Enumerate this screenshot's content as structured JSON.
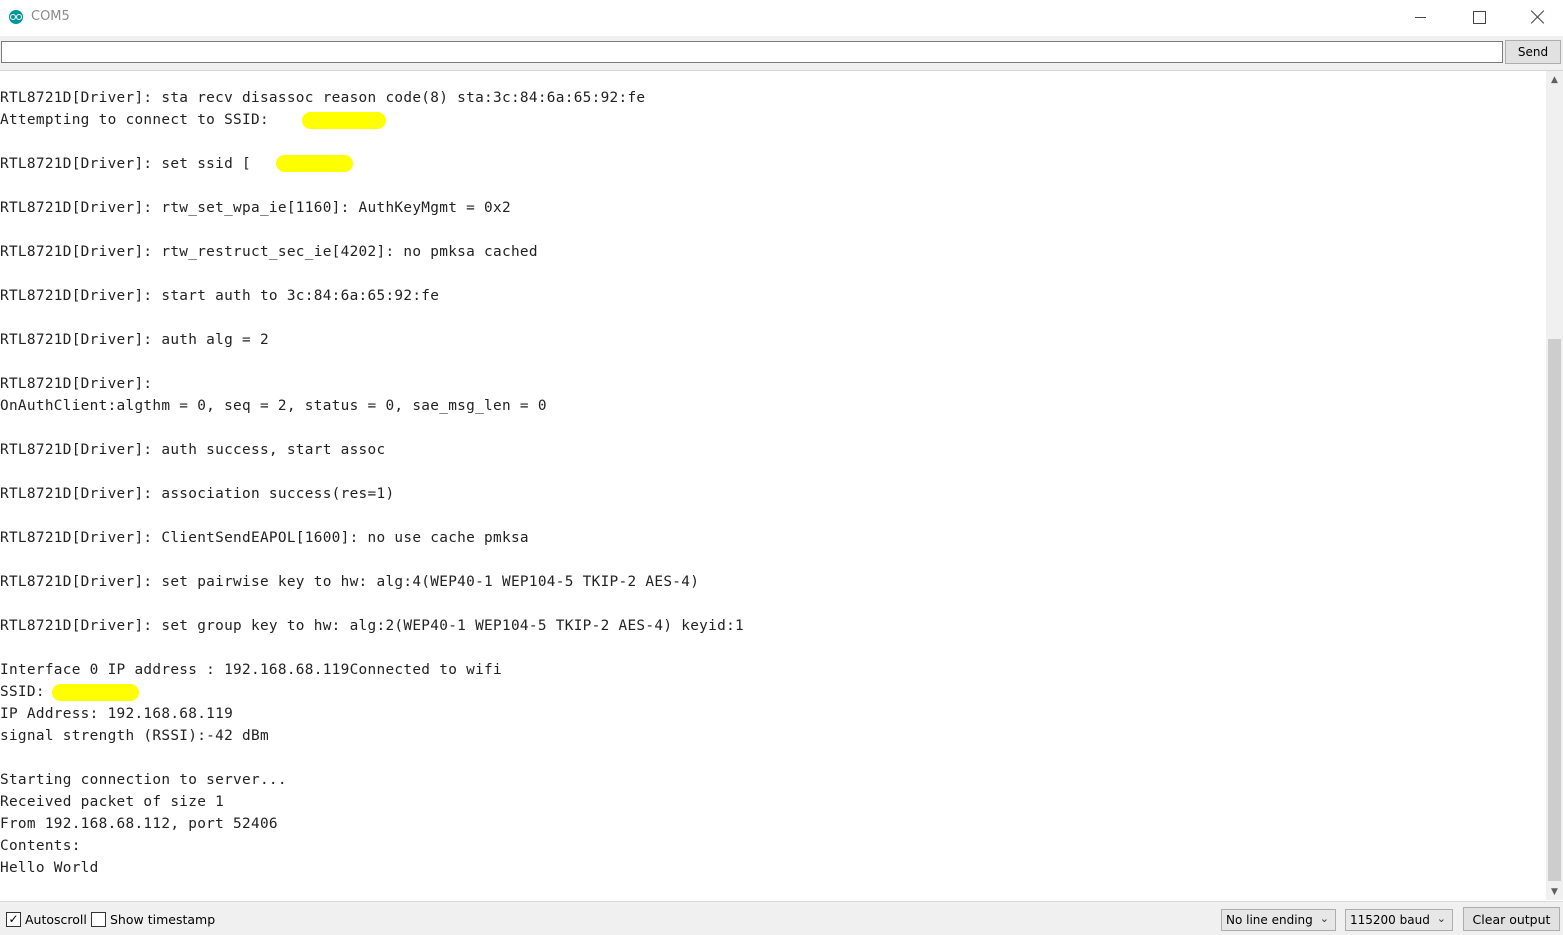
{
  "window": {
    "title": "COM5",
    "icon": "arduino-icon"
  },
  "send_bar": {
    "input_value": "",
    "send_label": "Send"
  },
  "output": {
    "lines": [
      "RTL8721D[Driver]: sta recv disassoc reason code(8) sta:3c:84:6a:65:92:fe",
      "Attempting to connect to SSID:",
      "",
      "RTL8721D[Driver]: set ssid [          ]",
      "",
      "RTL8721D[Driver]: rtw_set_wpa_ie[1160]: AuthKeyMgmt = 0x2",
      "",
      "RTL8721D[Driver]: rtw_restruct_sec_ie[4202]: no pmksa cached",
      "",
      "RTL8721D[Driver]: start auth to 3c:84:6a:65:92:fe",
      "",
      "RTL8721D[Driver]: auth alg = 2",
      "",
      "RTL8721D[Driver]:",
      "OnAuthClient:algthm = 0, seq = 2, status = 0, sae_msg_len = 0",
      "",
      "RTL8721D[Driver]: auth success, start assoc",
      "",
      "RTL8721D[Driver]: association success(res=1)",
      "",
      "RTL8721D[Driver]: ClientSendEAPOL[1600]: no use cache pmksa",
      "",
      "RTL8721D[Driver]: set pairwise key to hw: alg:4(WEP40-1 WEP104-5 TKIP-2 AES-4)",
      "",
      "RTL8721D[Driver]: set group key to hw: alg:2(WEP40-1 WEP104-5 TKIP-2 AES-4) keyid:1",
      "",
      "Interface 0 IP address : 192.168.68.119Connected to wifi",
      "SSID:",
      "IP Address: 192.168.68.119",
      "signal strength (RSSI):-42 dBm",
      "",
      "Starting connection to server...",
      "Received packet of size 1",
      "From 192.168.68.112, port 52406",
      "Contents:",
      "Hello World"
    ],
    "redaction_color": "#ffff00"
  },
  "bottom_bar": {
    "autoscroll": {
      "label": "Autoscroll",
      "checked": true
    },
    "timestamp": {
      "label": "Show timestamp",
      "checked": false
    },
    "line_ending": "No line ending",
    "baud_rate": "115200 baud",
    "clear_label": "Clear output"
  }
}
